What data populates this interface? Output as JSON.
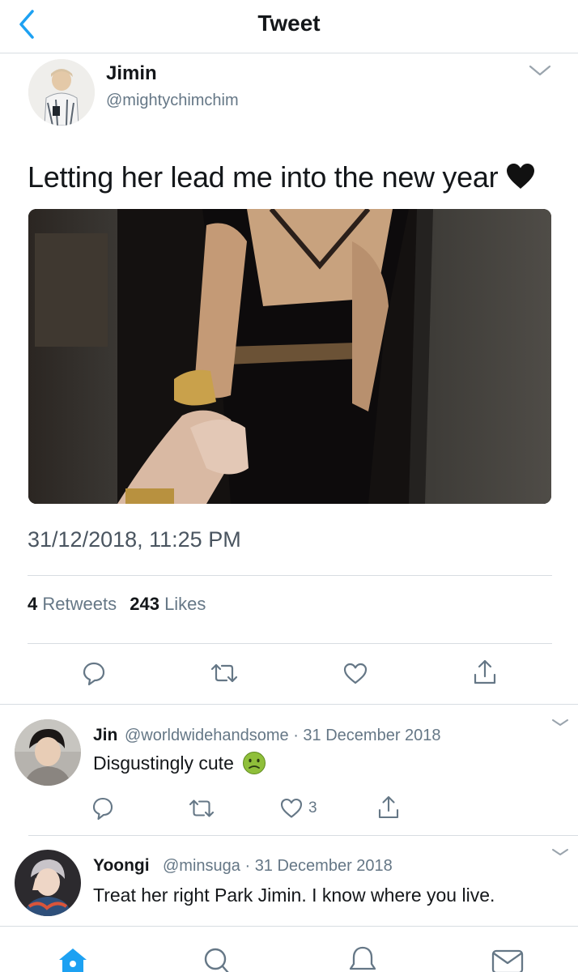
{
  "header": {
    "title": "Tweet"
  },
  "tweet": {
    "author_name": "Jimin",
    "author_handle": "@mightychimchim",
    "text": "Letting her lead me into the new year",
    "timestamp": "31/12/2018, 11:25 PM",
    "retweets_count": "4",
    "retweets_label": "Retweets",
    "likes_count": "243",
    "likes_label": "Likes"
  },
  "replies": [
    {
      "name": "Jin",
      "handle": "@worldwidehandsome",
      "date": "31 December 2018",
      "text": "Disgustingly cute",
      "likes": "3"
    },
    {
      "name": "Yoongi",
      "handle": "@minsuga",
      "date": "31 December 2018",
      "text": "Treat her right Park Jimin. I know where you live."
    }
  ],
  "colors": {
    "accent": "#1da1f2",
    "icon": "#657786",
    "text": "#14171a"
  },
  "icons": [
    "back-chevron-icon",
    "caret-down-icon",
    "reply-icon",
    "retweet-icon",
    "like-icon",
    "share-icon",
    "home-icon",
    "search-icon",
    "notifications-icon",
    "messages-icon"
  ]
}
